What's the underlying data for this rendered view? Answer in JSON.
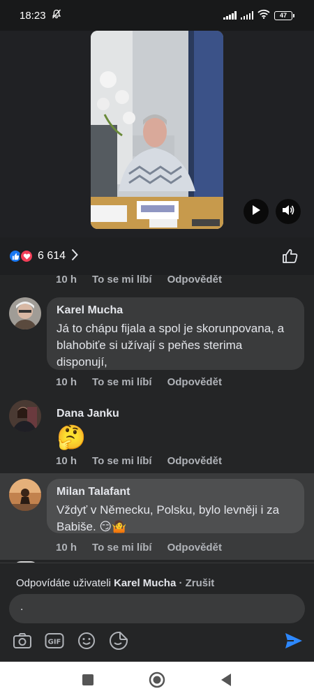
{
  "status": {
    "time": "18:23",
    "battery": "47"
  },
  "reactions": {
    "count": "6 614"
  },
  "top_meta": {
    "time": "10 h",
    "like": "To se mi líbí",
    "reply": "Odpovědět"
  },
  "comments": [
    {
      "author": "Karel Mucha",
      "text": "Já to chápu fijala a spol je skorunpovana, a blahobiťe si užívají s peňes sterima disponují,",
      "time": "10 h",
      "like": "To se mi líbí",
      "reply": "Odpovědět"
    },
    {
      "author": "Dana Janku",
      "text": "🤔",
      "time": "10 h",
      "like": "To se mi líbí",
      "reply": "Odpovědět"
    },
    {
      "author": "Milan Talafant",
      "text": "Vždyť v Německu, Polsku, bylo levněji i za Babiše. 😏🤷",
      "time": "10 h",
      "like": "To se mi líbí",
      "reply": "Odpovědět"
    }
  ],
  "composer": {
    "replying_prefix": "Odpovídáte uživateli ",
    "replying_name": "Karel Mucha",
    "cancel": " · Zrušit",
    "input_value": "."
  },
  "colors": {
    "background": "#18191a",
    "surface": "#242526",
    "bubble": "#3a3b3c",
    "accent": "#2d88ff"
  }
}
